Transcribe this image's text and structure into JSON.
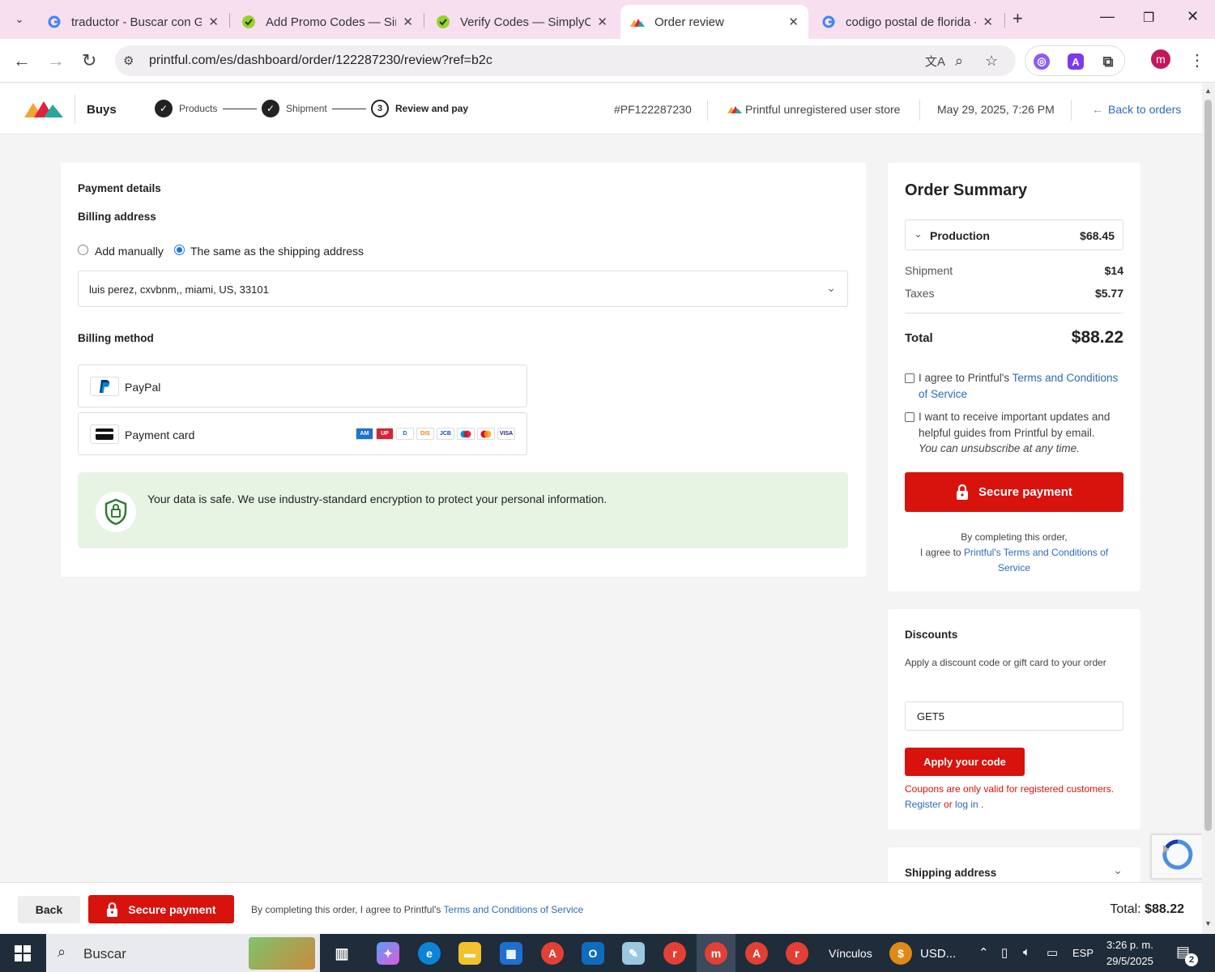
{
  "browser": {
    "tabs": [
      {
        "title": "traductor - Buscar con Go",
        "icon": "google-icon"
      },
      {
        "title": "Add Promo Codes — Simp",
        "icon": "simplycodes-icon"
      },
      {
        "title": "Verify Codes — SimplyCo",
        "icon": "simplycodes-icon"
      },
      {
        "title": "Order review",
        "icon": "printful-icon",
        "active": true
      },
      {
        "title": "codigo postal de florida -",
        "icon": "google-icon"
      }
    ],
    "url": "printful.com/es/dashboard/order/122287230/review?ref=b2c",
    "profile_initial": "m"
  },
  "header": {
    "brand": "Buys",
    "steps": [
      {
        "label": "Products",
        "state": "done"
      },
      {
        "label": "Shipment",
        "state": "done"
      },
      {
        "label": "Review and pay",
        "state": "current",
        "num": "3"
      }
    ],
    "order_id": "#PF122287230",
    "store": "Printful unregistered user store",
    "date": "May 29, 2025, 7:26 PM",
    "back_to_orders": "Back to orders"
  },
  "payment": {
    "title": "Payment details",
    "billing_address_title": "Billing address",
    "option_manual": "Add manually",
    "option_same": "The same as the shipping address",
    "selected_address": "luis perez, cxvbnm,, miami, US, 33101",
    "billing_method_title": "Billing method",
    "methods": {
      "paypal": "PayPal",
      "card": "Payment card"
    },
    "card_brands": [
      "amex",
      "unionpay",
      "diners",
      "discover",
      "jcb",
      "maestro",
      "mastercard",
      "visa"
    ],
    "safe_notice": "Your data is safe. We use industry-standard encryption to protect your personal information."
  },
  "summary": {
    "title": "Order Summary",
    "production_label": "Production",
    "production_value": "$68.45",
    "shipment_label": "Shipment",
    "shipment_value": "$14",
    "taxes_label": "Taxes",
    "taxes_value": "$5.77",
    "total_label": "Total",
    "total_value": "$88.22",
    "agree_prefix": "I agree to Printful's ",
    "agree_link": "Terms and Conditions of Service",
    "updates_text": "I want to receive important updates and helpful guides from Printful by email.",
    "unsubscribe": "You can unsubscribe at any time.",
    "secure_payment": "Secure payment",
    "note_line1": "By completing this order,",
    "note_prefix": "I agree to ",
    "note_link": "Printful's Terms and Conditions of Service"
  },
  "discounts": {
    "title": "Discounts",
    "description": "Apply a discount code or gift card to your order",
    "code_value": "GET5",
    "apply_label": "Apply your code",
    "error_text": "Coupons are only valid for registered customers. ",
    "register_link": "Register",
    "or": " or ",
    "login_link": "log in",
    "dot": " ."
  },
  "shipping_address_title": "Shipping address",
  "bottom": {
    "back": "Back",
    "secure_payment": "Secure payment",
    "note_prefix": "By completing this order, I agree to Printful's ",
    "note_link": "Terms and Conditions of Service",
    "total_label": "Total: ",
    "total_value": "$88.22"
  },
  "taskbar": {
    "search": "Buscar",
    "links": "Vínculos",
    "currency": "USD...",
    "lang": "ESP",
    "time": "3:26 p. m.",
    "date": "29/5/2025",
    "notif_count": "2"
  },
  "colors": {
    "accent_red": "#d8120c",
    "link_blue": "#2b6bb8",
    "safe_green": "#e7f4e4"
  }
}
